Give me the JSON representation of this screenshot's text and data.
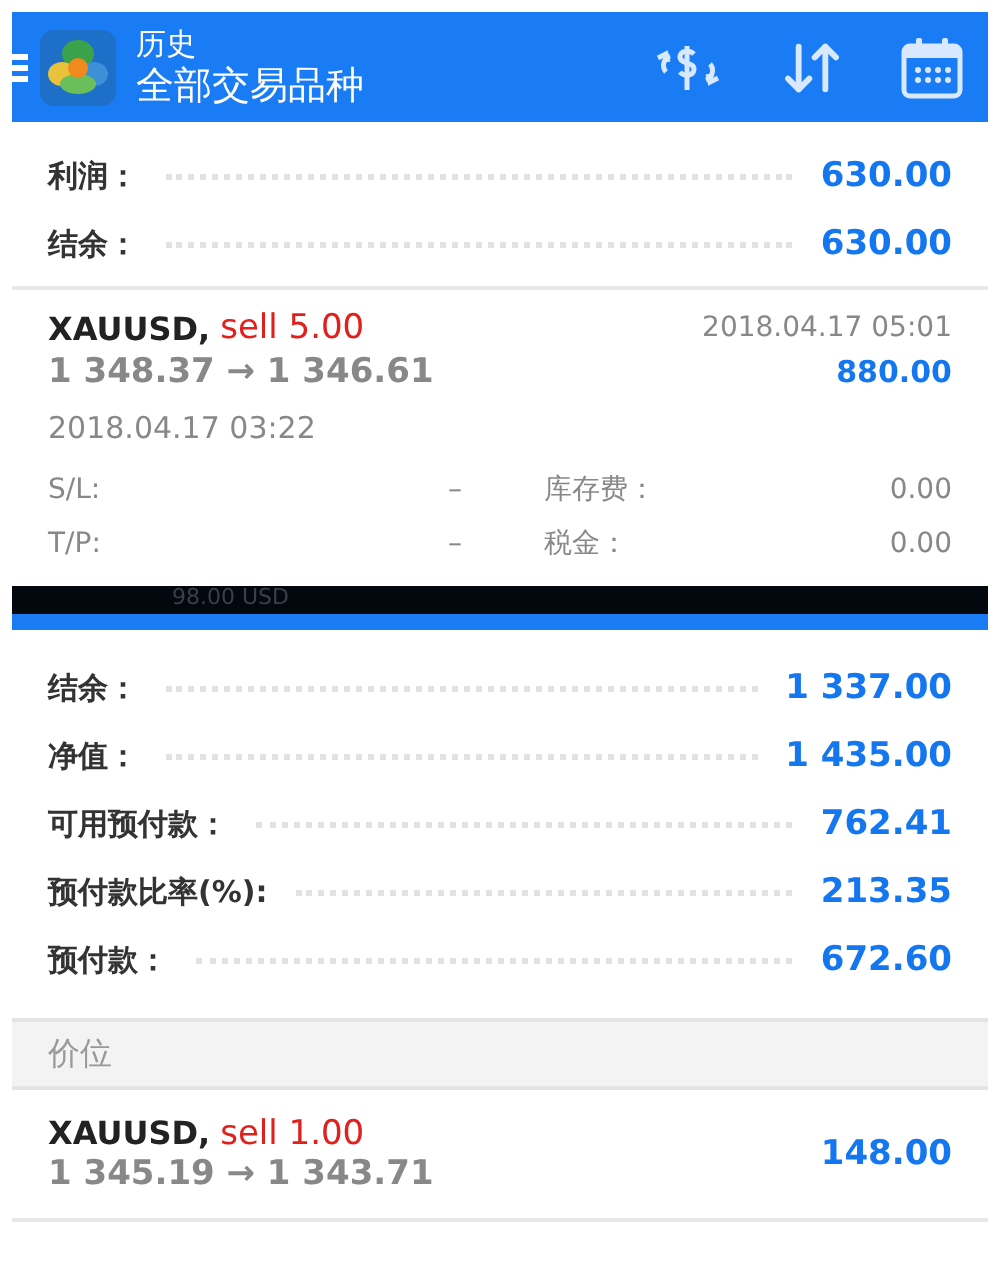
{
  "header": {
    "title": "历史",
    "subtitle": "全部交易品种"
  },
  "totals": [
    {
      "label": "利润：",
      "value": "630.00"
    },
    {
      "label": "结余：",
      "value": "630.00"
    }
  ],
  "deal": {
    "symbol": "XAUUSD,",
    "side": "sell 5.00",
    "prices": "1 348.37 → 1 346.61",
    "close_time": "2018.04.17 05:01",
    "profit": "880.00",
    "open_time": "2018.04.17 03:22",
    "details": [
      {
        "label": "S/L:",
        "value": "–",
        "label_2": "库存费：",
        "value_2": "0.00"
      },
      {
        "label": "T/P:",
        "value": "–",
        "label_2": "税金：",
        "value_2": "0.00"
      }
    ]
  },
  "overlay_strip": {
    "text": "98.00 USD"
  },
  "account": [
    {
      "label": "结余：",
      "value": "1 337.00"
    },
    {
      "label": "净值：",
      "value": "1 435.00"
    },
    {
      "label": "可用预付款：",
      "value": "762.41"
    },
    {
      "label": "预付款比率(%):",
      "value": "213.35"
    },
    {
      "label": "预付款：",
      "value": "672.60"
    }
  ],
  "section": {
    "title": "价位"
  },
  "positions": [
    {
      "symbol": "XAUUSD,",
      "side": "sell 1.00",
      "prices": "1 345.19 → 1 343.71",
      "profit": "148.00"
    }
  ]
}
